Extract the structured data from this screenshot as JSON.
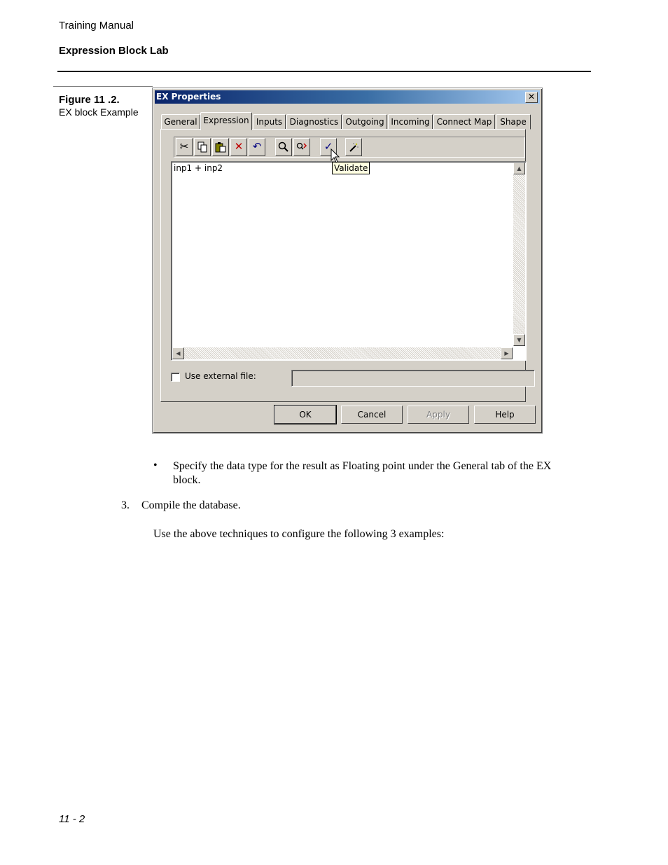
{
  "header": {
    "manual_title": "Training Manual",
    "section_title": "Expression Block Lab"
  },
  "figure": {
    "label": "Figure 11 .2.",
    "caption": "EX block Example"
  },
  "dialog": {
    "title": "EX Properties",
    "close_glyph": "✕",
    "tabs": [
      "General",
      "Expression",
      "Inputs",
      "Diagnostics",
      "Outgoing",
      "Incoming",
      "Connect Map",
      "Shape"
    ],
    "active_tab": "Expression",
    "toolbar_icons": [
      "cut-icon",
      "copy-icon",
      "paste-icon",
      "delete-icon",
      "undo-icon",
      "find-icon",
      "replace-icon",
      "validate-icon",
      "wizard-icon"
    ],
    "expression_text": "inp1 + inp2",
    "tooltip": "Validate",
    "use_external_file_label": "Use external file:",
    "external_file_value": "",
    "use_external_file_checked": false,
    "buttons": {
      "ok": "OK",
      "cancel": "Cancel",
      "apply": "Apply",
      "help": "Help"
    }
  },
  "content": {
    "bullet": "Specify the data type for the result as Floating point under the General tab of the EX block.",
    "step_number": "3.",
    "step_text": "Compile the database.",
    "paragraph": "Use the above techniques to configure the following 3 examples:"
  },
  "footer": {
    "page_number": "11 - 2"
  },
  "colors": {
    "titlebar_start": "#0a246a",
    "titlebar_end": "#a6caf0",
    "dialog_face": "#d4d0c8",
    "tooltip_bg": "#ffffe1"
  }
}
